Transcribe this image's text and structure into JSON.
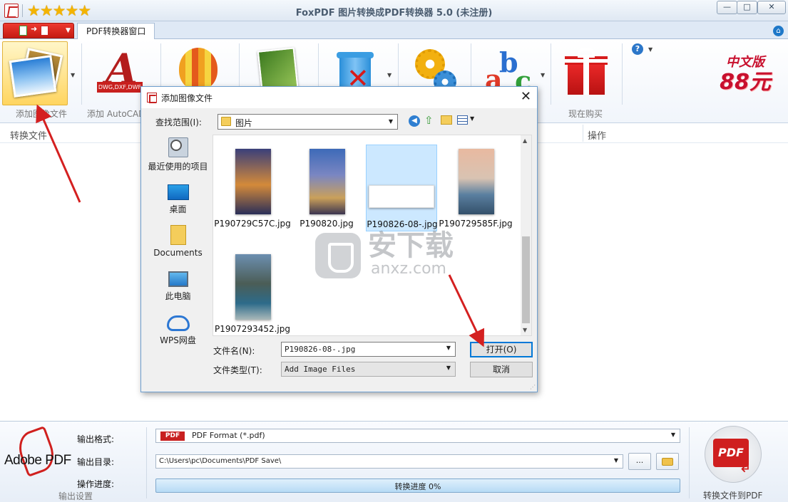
{
  "window": {
    "title": "FoxPDF 图片转换成PDF转换器 5.0 (未注册)",
    "stars": "★★★★★",
    "min": "—",
    "max": "□",
    "close": "✕"
  },
  "tabs": {
    "active": "PDF转换器窗口"
  },
  "ribbon": {
    "buttons": [
      {
        "label": "添加图像文件",
        "icon": "photos-icon"
      },
      {
        "label": "添加 AutoCAD",
        "icon": "autocad-icon",
        "tag": "DWG,DXF,DWF"
      },
      {
        "label": "",
        "icon": "balloon-icon"
      },
      {
        "label": "",
        "icon": "book-icon"
      },
      {
        "label": "",
        "icon": "recycle-bin-icon"
      },
      {
        "label": "",
        "icon": "gear-icon"
      },
      {
        "label": "",
        "icon": "abc-icon"
      },
      {
        "label": "现在购买",
        "icon": "gift-icon"
      }
    ],
    "promo_line1": "中文版",
    "promo_line2": "88元"
  },
  "workspace": {
    "left_label": "转换文件",
    "right_label": "操作"
  },
  "dialog": {
    "title": "添加图像文件",
    "look_in_label": "查找范围(I):",
    "look_in_value": "图片",
    "places": [
      "最近使用的项目",
      "桌面",
      "Documents",
      "此电脑",
      "WPS网盘"
    ],
    "files": [
      {
        "name": "P190729C57C.jpg",
        "selected": false
      },
      {
        "name": "P190820.jpg",
        "selected": false
      },
      {
        "name": "P190826-08-.jpg",
        "selected": true
      },
      {
        "name": "P190729585F.jpg",
        "selected": false
      },
      {
        "name": "P1907293452.jpg",
        "selected": false
      }
    ],
    "filename_label": "文件名(N):",
    "filename_value": "P190826-08-.jpg",
    "filetype_label": "文件类型(T):",
    "filetype_value": "Add Image Files",
    "open_button": "打开(O)",
    "cancel_button": "取消"
  },
  "output": {
    "adobe_logo": "Adobe PDF",
    "format_label": "输出格式:",
    "format_badge": "PDF",
    "format_value": "PDF Format (*.pdf)",
    "dir_label": "输出目录:",
    "dir_value": "C:\\Users\\pc\\Documents\\PDF Save\\",
    "browse_button": "...",
    "progress_label": "操作进度:",
    "progress_text": "转换进度 0%",
    "progress_value": 0,
    "group_label": "输出设置",
    "convert_label": "转换文件到PDF",
    "convert_icon_text": "PDF"
  },
  "watermark": {
    "cn": "安下载",
    "en": "anxz.com"
  },
  "colors": {
    "accent_red": "#c8201e",
    "selection_blue": "#cce8ff",
    "annotation_red": "#d42020"
  }
}
